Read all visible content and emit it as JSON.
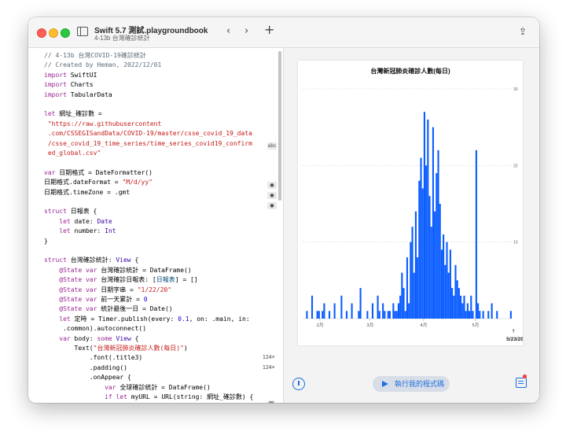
{
  "window": {
    "title": "Swift 5.7 測試.playgroundbook",
    "subtitle": "4-13b 台灣確診統計",
    "icons": [
      "sidebar-icon",
      "chevron-left-icon",
      "chevron-right-icon",
      "plus-icon",
      "share-icon"
    ]
  },
  "code": {
    "lines": [
      [
        {
          "t": "// 4-13b 台灣COVID-19確診統計",
          "c": "cm"
        }
      ],
      [
        {
          "t": "// Created by Heman, 2022/12/01",
          "c": "cm"
        }
      ],
      [
        {
          "t": "import",
          "c": "kw"
        },
        {
          "t": " SwiftUI",
          "c": ""
        }
      ],
      [
        {
          "t": "import",
          "c": "kw"
        },
        {
          "t": " Charts",
          "c": ""
        }
      ],
      [
        {
          "t": "import",
          "c": "kw"
        },
        {
          "t": " TabularData",
          "c": ""
        }
      ],
      [
        {
          "t": "",
          "c": ""
        }
      ],
      [
        {
          "t": "let",
          "c": "kw"
        },
        {
          "t": " 網址_確診數 =",
          "c": ""
        }
      ],
      [
        {
          "t": " \"https://raw.githubusercontent",
          "c": "str"
        }
      ],
      [
        {
          "t": " .com/CSSEGISandData/COVID-19/master/csse_covid_19_data",
          "c": "str"
        }
      ],
      [
        {
          "t": " /csse_covid_19_time_series/time_series_covid19_confirm",
          "c": "str"
        }
      ],
      [
        {
          "t": " ed_global.csv\"",
          "c": "str"
        }
      ],
      [
        {
          "t": "",
          "c": ""
        }
      ],
      [
        {
          "t": "var",
          "c": "kw"
        },
        {
          "t": " 日期格式 = DateFormatter()",
          "c": ""
        }
      ],
      [
        {
          "t": "日期格式.dateFormat = ",
          "c": ""
        },
        {
          "t": "\"M/d/yy\"",
          "c": "str"
        }
      ],
      [
        {
          "t": "日期格式.timeZone = .gmt",
          "c": ""
        }
      ],
      [
        {
          "t": "",
          "c": ""
        }
      ],
      [
        {
          "t": "struct",
          "c": "kw"
        },
        {
          "t": " 日報表 {",
          "c": ""
        }
      ],
      [
        {
          "t": "    ",
          "c": ""
        },
        {
          "t": "let",
          "c": "kw"
        },
        {
          "t": " date: ",
          "c": ""
        },
        {
          "t": "Date",
          "c": "tyc"
        }
      ],
      [
        {
          "t": "    ",
          "c": ""
        },
        {
          "t": "let",
          "c": "kw"
        },
        {
          "t": " number: ",
          "c": ""
        },
        {
          "t": "Int",
          "c": "tyc"
        }
      ],
      [
        {
          "t": "}",
          "c": ""
        }
      ],
      [
        {
          "t": "",
          "c": ""
        }
      ],
      [
        {
          "t": "struct",
          "c": "kw"
        },
        {
          "t": " 台灣確診統計: ",
          "c": ""
        },
        {
          "t": "View",
          "c": "tyc"
        },
        {
          "t": " {",
          "c": ""
        }
      ],
      [
        {
          "t": "    @State ",
          "c": "kw"
        },
        {
          "t": "var",
          "c": "kw"
        },
        {
          "t": " 台灣確診統計 = DataFrame()",
          "c": ""
        }
      ],
      [
        {
          "t": "    @State ",
          "c": "kw"
        },
        {
          "t": "var",
          "c": "kw"
        },
        {
          "t": " 台灣確診日報表: [",
          "c": ""
        },
        {
          "t": "日報表",
          "c": "ty"
        },
        {
          "t": "] = []",
          "c": ""
        }
      ],
      [
        {
          "t": "    @State ",
          "c": "kw"
        },
        {
          "t": "var",
          "c": "kw"
        },
        {
          "t": " 日期字串 = ",
          "c": ""
        },
        {
          "t": "\"1/22/20\"",
          "c": "str"
        }
      ],
      [
        {
          "t": "    @State ",
          "c": "kw"
        },
        {
          "t": "var",
          "c": "kw"
        },
        {
          "t": " 前一天累計 = ",
          "c": ""
        },
        {
          "t": "0",
          "c": "num"
        }
      ],
      [
        {
          "t": "    @State ",
          "c": "kw"
        },
        {
          "t": "var",
          "c": "kw"
        },
        {
          "t": " 統計最後一日 = Date()",
          "c": ""
        }
      ],
      [
        {
          "t": "    ",
          "c": ""
        },
        {
          "t": "let",
          "c": "kw"
        },
        {
          "t": " 定時 = Timer.publish(every: ",
          "c": ""
        },
        {
          "t": "0.1",
          "c": "num"
        },
        {
          "t": ", on: .main, in:",
          "c": ""
        }
      ],
      [
        {
          "t": "     .common).autoconnect()",
          "c": ""
        }
      ],
      [
        {
          "t": "    ",
          "c": ""
        },
        {
          "t": "var",
          "c": "kw"
        },
        {
          "t": " body: ",
          "c": ""
        },
        {
          "t": "some",
          "c": "kw"
        },
        {
          "t": " ",
          "c": ""
        },
        {
          "t": "View",
          "c": "tyc"
        },
        {
          "t": " {",
          "c": ""
        }
      ],
      [
        {
          "t": "        Text(",
          "c": ""
        },
        {
          "t": "\"台灣新冠肺炎確診人數(每日)\"",
          "c": "str"
        },
        {
          "t": ")",
          "c": ""
        }
      ],
      [
        {
          "t": "            .font(.title3)",
          "c": ""
        }
      ],
      [
        {
          "t": "            .padding()",
          "c": ""
        }
      ],
      [
        {
          "t": "            .onAppear {",
          "c": ""
        }
      ],
      [
        {
          "t": "                ",
          "c": ""
        },
        {
          "t": "var",
          "c": "kw"
        },
        {
          "t": " 全球確診統計 = DataFrame()",
          "c": ""
        }
      ],
      [
        {
          "t": "                ",
          "c": ""
        },
        {
          "t": "if let",
          "c": "kw"
        },
        {
          "t": " myURL = URL(string: 網址_確診數) {",
          "c": ""
        }
      ]
    ],
    "gutter": {
      "abc_badge": "abc",
      "dot_badge": "●",
      "count_body": "124×",
      "count_text": "124×",
      "grid_icon": "grid-icon"
    }
  },
  "chart_data": {
    "type": "bar",
    "title": "台灣新冠肺炎確診人數(每日)",
    "x_ticks": [
      "2月",
      "3月",
      "4月",
      "5月"
    ],
    "y_ticks": [
      10,
      20,
      30
    ],
    "ylim": [
      0,
      30
    ],
    "grid": true,
    "last_date_label": "5/23/20",
    "series": [
      {
        "color": "#0a5cff",
        "values": [
          0,
          0,
          1,
          0,
          0,
          3,
          0,
          0,
          1,
          1,
          0,
          1,
          2,
          0,
          0,
          1,
          0,
          0,
          2,
          0,
          0,
          0,
          3,
          0,
          0,
          1,
          0,
          0,
          2,
          0,
          0,
          0,
          1,
          4,
          0,
          0,
          0,
          1,
          0,
          0,
          2,
          0,
          0,
          3,
          1,
          0,
          2,
          1,
          0,
          1,
          1,
          0,
          2,
          1,
          1,
          2,
          3,
          6,
          4,
          1,
          8,
          2,
          10,
          12,
          6,
          14,
          8,
          18,
          21,
          17,
          27,
          20,
          26,
          16,
          12,
          25,
          14,
          19,
          22,
          15,
          9,
          11,
          7,
          10,
          6,
          9,
          4,
          3,
          7,
          5,
          4,
          3,
          2,
          3,
          1,
          2,
          1,
          3,
          1,
          0,
          22,
          2,
          1,
          0,
          1,
          0,
          0,
          1,
          0,
          2,
          0,
          0,
          1,
          0,
          0,
          0,
          0,
          0,
          0,
          0,
          1
        ]
      }
    ]
  },
  "run_button": {
    "label": "執行我的程式碼"
  },
  "bottom_icons": [
    "speed-icon",
    "play-icon",
    "console-log-icon"
  ]
}
